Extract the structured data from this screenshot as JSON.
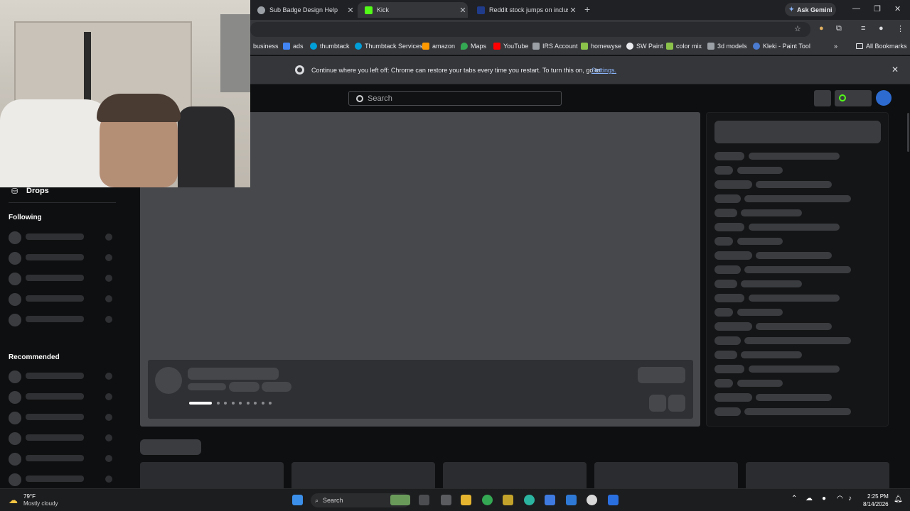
{
  "browser": {
    "tabs": [
      {
        "title": "Sub Badge Design Help",
        "favicon_color": "#9aa0a6",
        "active": false
      },
      {
        "title": "Kick",
        "favicon_color": "#53fc18",
        "active": true
      },
      {
        "title": "Reddit stock jumps on inclusio",
        "favicon_color": "#1f3b8a",
        "active": false
      }
    ],
    "ask_gemini": "Ask Gemini",
    "bookmarks": [
      {
        "label": "business",
        "icon": "globe-icon",
        "color": "#9aa0a6"
      },
      {
        "label": "ads",
        "icon": "google-ads-icon",
        "color": "#4285f4"
      },
      {
        "label": "thumbtack",
        "icon": "thumbtack-icon",
        "color": "#009fd9"
      },
      {
        "label": "Thumbtack Services",
        "icon": "thumbtack-icon",
        "color": "#009fd9"
      },
      {
        "label": "amazon",
        "icon": "amazon-icon",
        "color": "#ff9900"
      },
      {
        "label": "Maps",
        "icon": "maps-icon",
        "color": "#34a853"
      },
      {
        "label": "YouTube",
        "icon": "youtube-icon",
        "color": "#ff0000"
      },
      {
        "label": "IRS Account",
        "icon": "irs-icon",
        "color": "#9aa0a6"
      },
      {
        "label": "homewyse",
        "icon": "homewyse-icon",
        "color": "#8bc34a"
      },
      {
        "label": "SW Paint",
        "icon": "paint-icon",
        "color": "#e8eaed"
      },
      {
        "label": "color mix",
        "icon": "color-mix-icon",
        "color": "#8bc34a"
      },
      {
        "label": "3d models",
        "icon": "3d-model-icon",
        "color": "#9aa0a6"
      },
      {
        "label": "Kleki - Paint Tool",
        "icon": "kleki-icon",
        "color": "#4a7bd0"
      }
    ],
    "all_bookmarks": "All Bookmarks",
    "infobar": {
      "text": "Continue where you left off: Chrome can restore your tabs every time you restart. To turn this on, go to",
      "link": "Settings."
    }
  },
  "kick": {
    "search_placeholder": "Search",
    "sidebar": {
      "drops": "Drops",
      "following": "Following",
      "recommended": "Recommended"
    },
    "accent": "#53fc18"
  },
  "taskbar": {
    "weather_temp": "79°F",
    "weather_desc": "Mostly cloudy",
    "search": "Search",
    "time": "2:25 PM",
    "date": "8/14/2026"
  }
}
